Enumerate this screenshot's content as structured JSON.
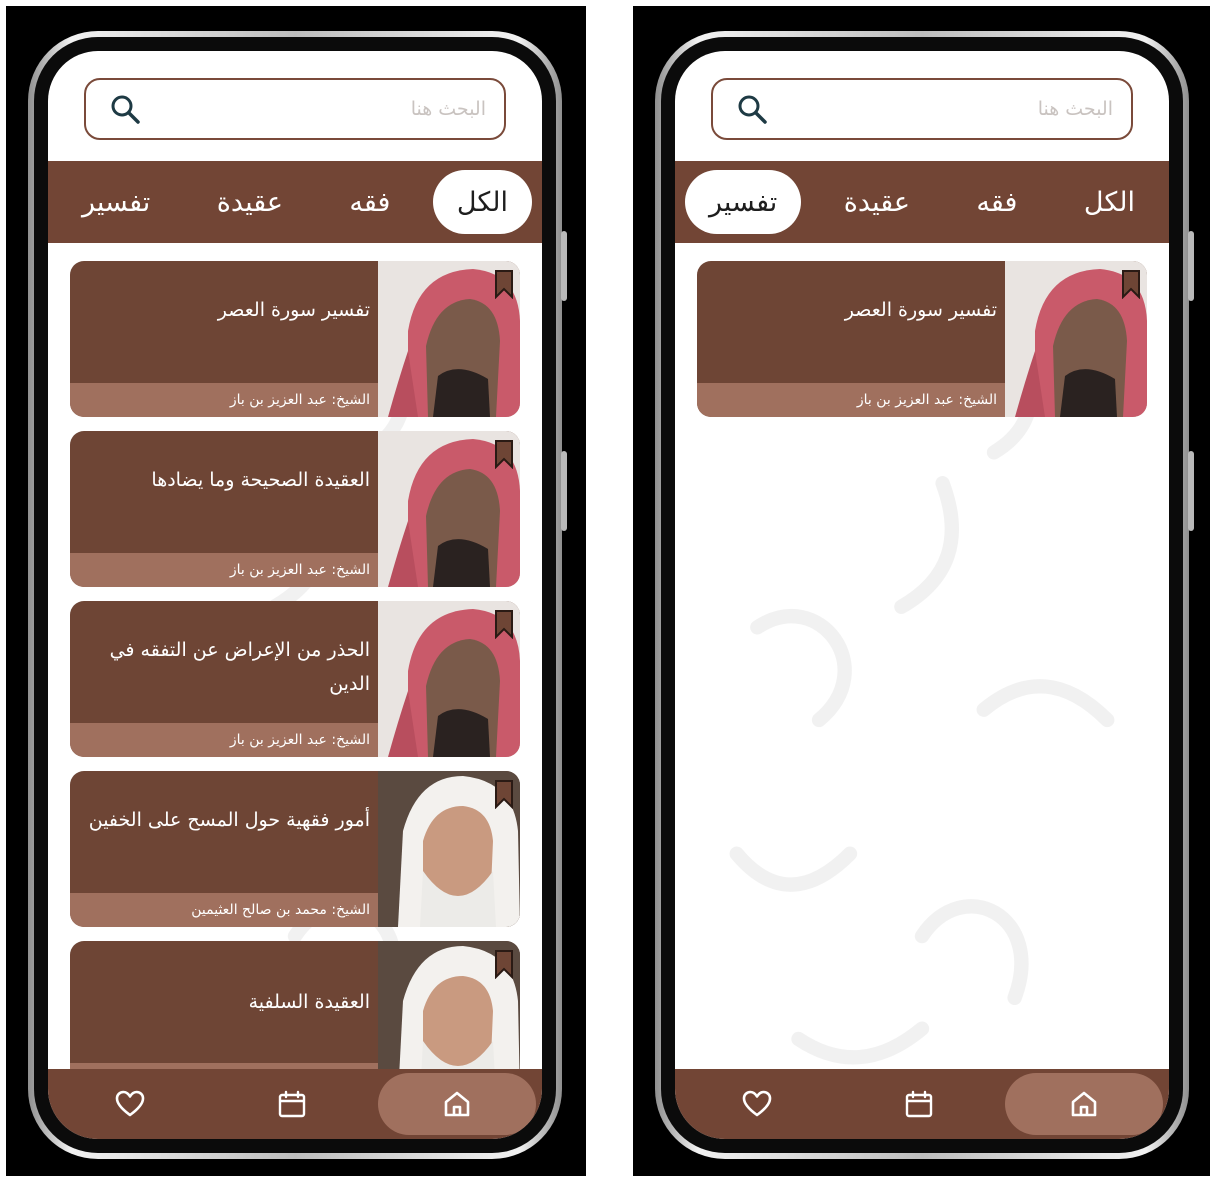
{
  "colors": {
    "brand_brown": "#724535",
    "card_brown": "#6e4535",
    "footer_tan": "#a0705e",
    "border_brown": "#7a4a3a",
    "white": "#ffffff"
  },
  "icons": {
    "search": "search-icon",
    "bookmark": "bookmark-icon",
    "favorites": "heart-icon",
    "calendar": "calendar-icon",
    "home": "home-icon"
  },
  "screens": [
    {
      "search_placeholder": "البحث هنا",
      "selected_tab": "الكل",
      "tabs": [
        {
          "label": "الكل"
        },
        {
          "label": "فقه"
        },
        {
          "label": "عقيدة"
        },
        {
          "label": "تفسير"
        }
      ],
      "cards": [
        {
          "title": "تفسير سورة العصر",
          "author": "الشيخ: عبد العزيز بن باز"
        },
        {
          "title": "العقيدة الصحيحة وما يضادها",
          "author": "الشيخ: عبد العزيز بن باز"
        },
        {
          "title": "الحذر من الإعراض عن التفقه في الدين",
          "author": "الشيخ: عبد العزيز بن باز"
        },
        {
          "title": "أمور فقهية حول المسح على الخفين",
          "author": "الشيخ: محمد بن صالح العثيمين"
        },
        {
          "title": "العقيدة السلفية",
          "author": ""
        }
      ]
    },
    {
      "search_placeholder": "البحث هنا",
      "selected_tab": "تفسير",
      "tabs": [
        {
          "label": "الكل"
        },
        {
          "label": "فقه"
        },
        {
          "label": "عقيدة"
        },
        {
          "label": "تفسير"
        }
      ],
      "cards": [
        {
          "title": "تفسير سورة العصر",
          "author": "الشيخ: عبد العزيز بن باز"
        }
      ]
    }
  ]
}
